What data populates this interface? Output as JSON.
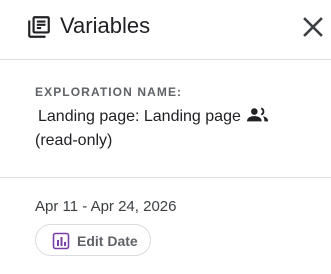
{
  "header": {
    "title": "Variables",
    "icon": "library-books-icon",
    "close_icon": "close-icon"
  },
  "exploration": {
    "label": "EXPLORATION NAME:",
    "name": "Landing page: Landing page",
    "suffix": "(read-only)",
    "shared_icon": "group-icon"
  },
  "date": {
    "range": "Apr 11 - Apr 24, 2026",
    "edit_label": "Edit Date",
    "edit_icon": "calendar-chart-icon",
    "accent_color": "#7b3fa8"
  },
  "colors": {
    "text_primary": "#202124",
    "text_secondary": "#5f6368",
    "divider": "#e0e0e0"
  }
}
